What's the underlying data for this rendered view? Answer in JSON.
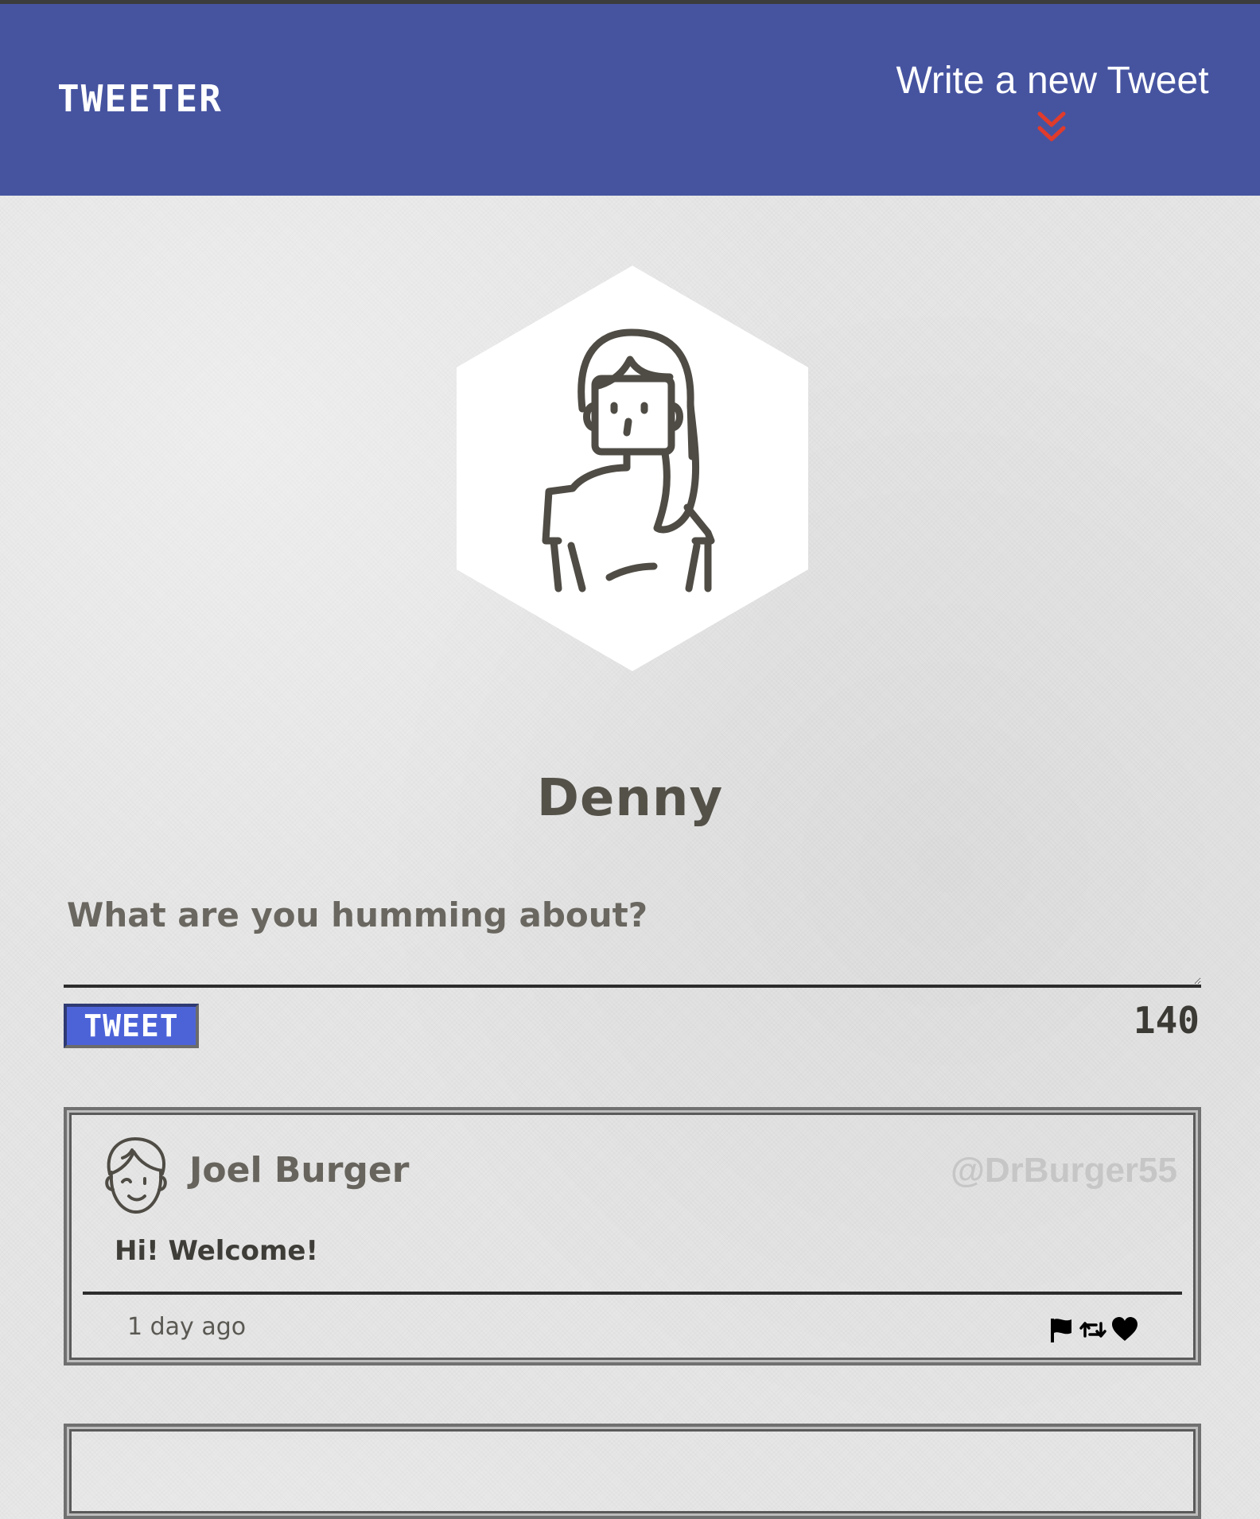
{
  "nav": {
    "brand": "TWEETER",
    "compose_toggle_label": "Write a new Tweet",
    "compose_toggle_icon": "double-chevron-down-icon",
    "background": "#4654a0",
    "chevron_color": "#e03b2c"
  },
  "profile": {
    "name": "Denny",
    "avatar_icon": "woman-avatar-icon"
  },
  "composer": {
    "label": "What are you humming about?",
    "value": "",
    "submit_label": "TWEET",
    "char_counter": "140",
    "button_color": "#4c63d8"
  },
  "tweets": [
    {
      "author": "Joel Burger",
      "handle": "@DrBurger55",
      "avatar_icon": "man-avatar-icon",
      "text": "Hi! Welcome!",
      "time": "1 day ago",
      "actions": [
        "flag-icon",
        "retweet-icon",
        "heart-icon"
      ]
    }
  ]
}
